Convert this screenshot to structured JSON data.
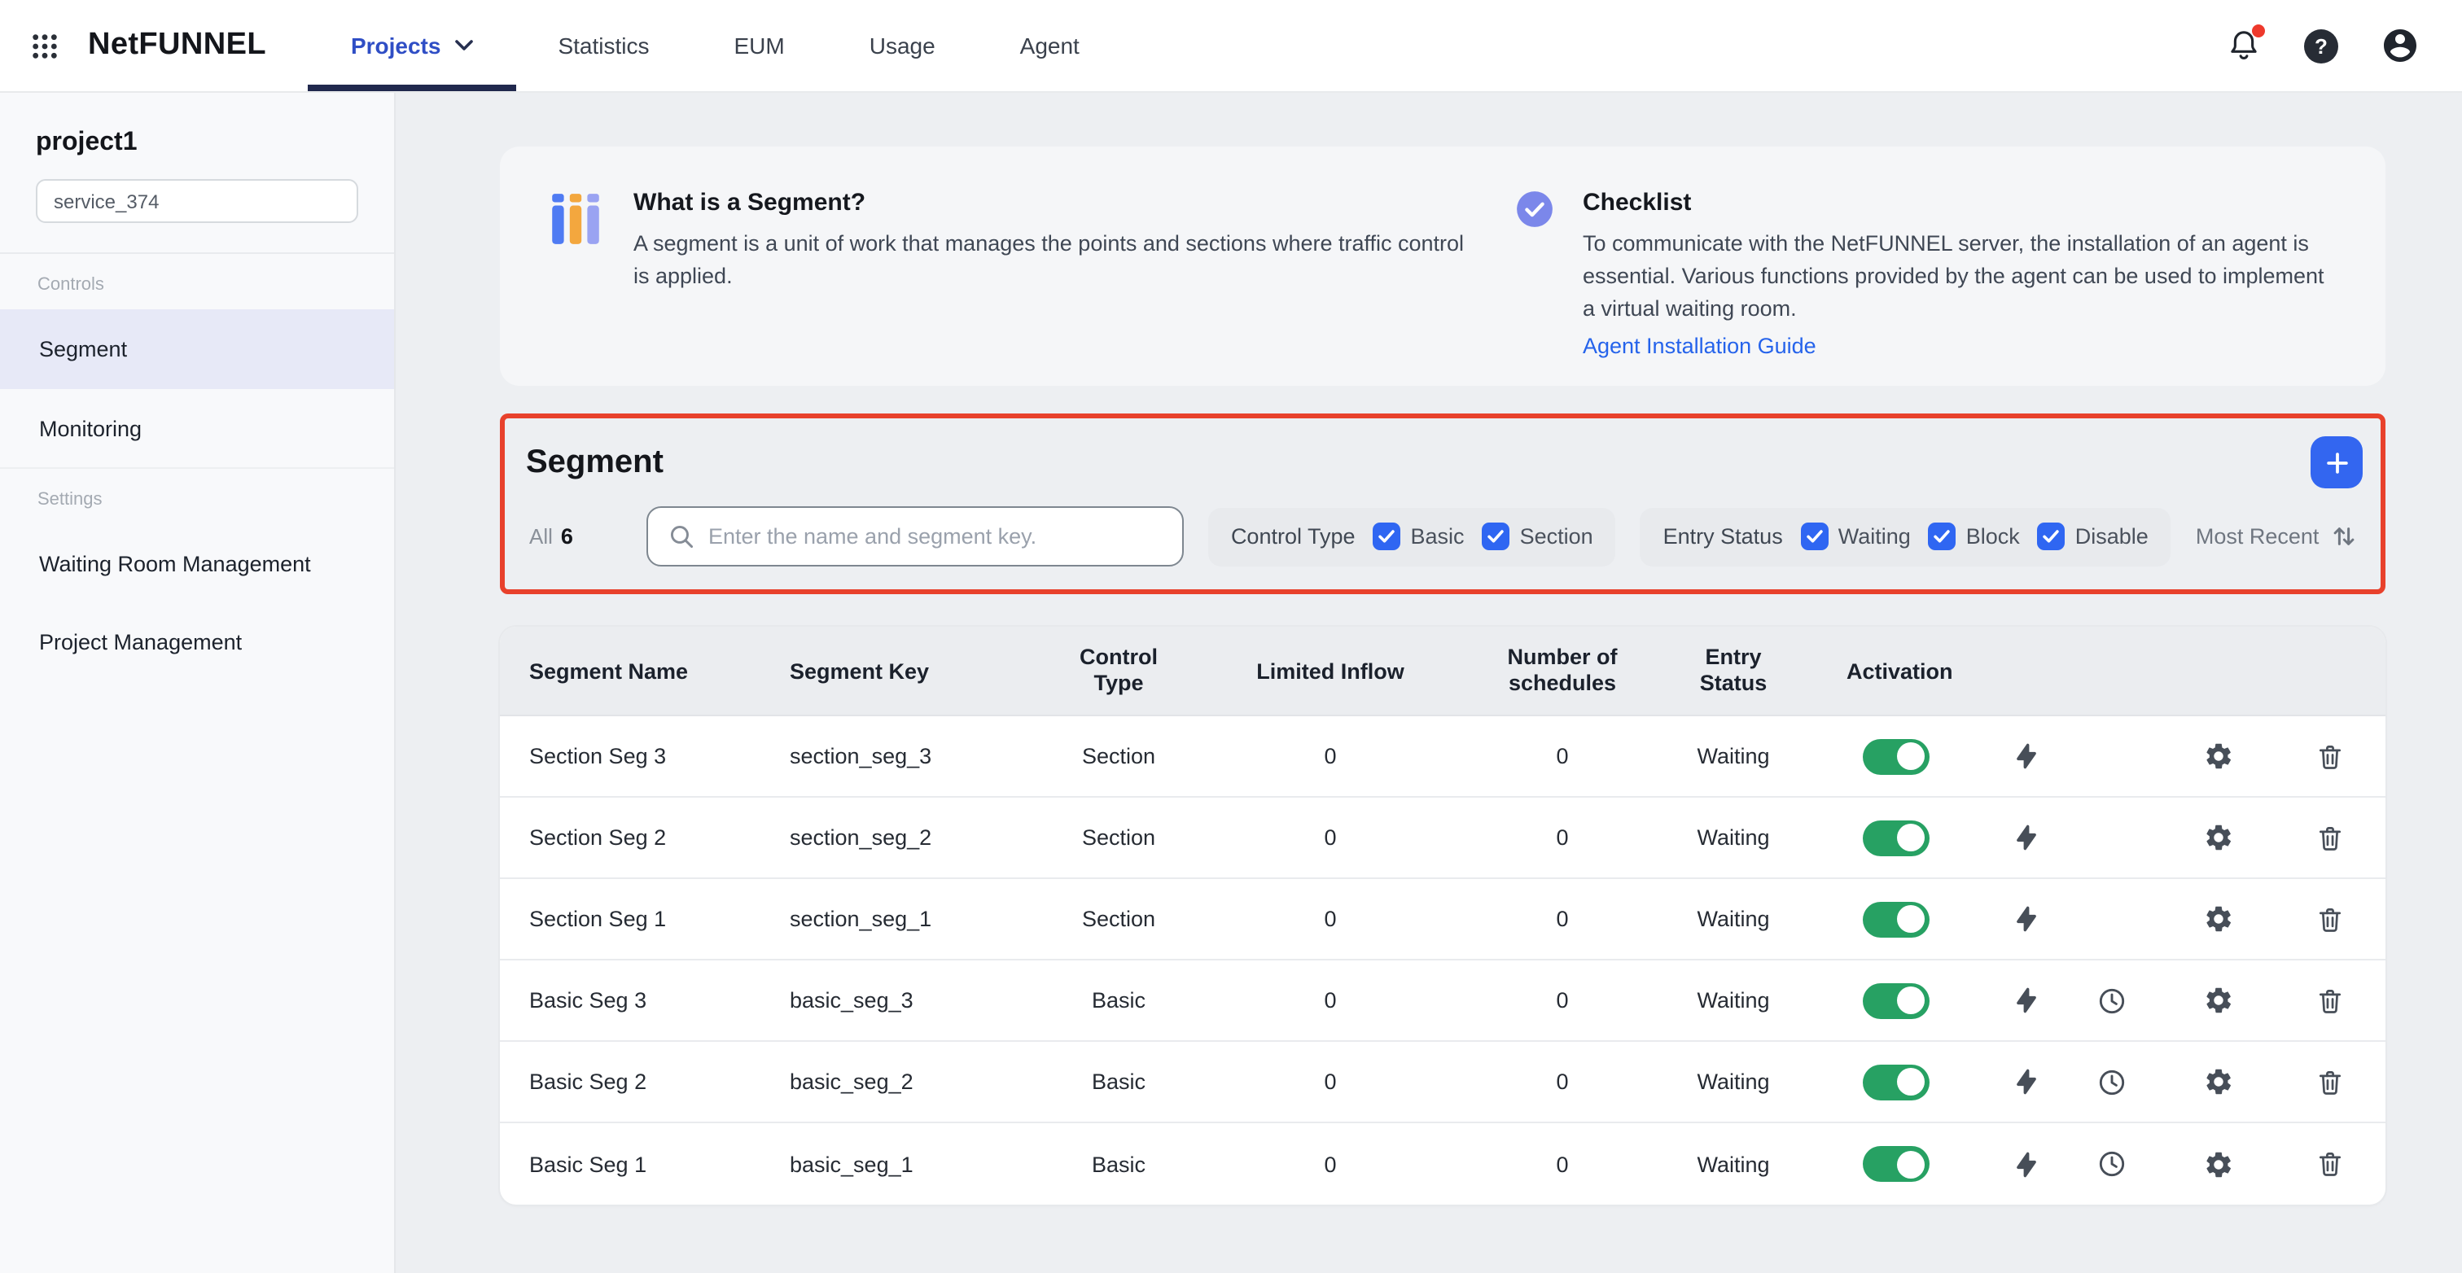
{
  "topbar": {
    "brand": "NetFUNNEL",
    "nav": {
      "projects": "Projects",
      "statistics": "Statistics",
      "eum": "EUM",
      "usage": "Usage",
      "agent": "Agent"
    }
  },
  "sidebar": {
    "project_name": "project1",
    "service_selected": "service_374",
    "controls_label": "Controls",
    "controls_items": {
      "segment": "Segment",
      "monitoring": "Monitoring"
    },
    "settings_label": "Settings",
    "settings_items": {
      "waiting_room": "Waiting Room Management",
      "project_mgmt": "Project Management"
    }
  },
  "cards": {
    "segment_info": {
      "title": "What is a Segment?",
      "body": "A segment is a unit of work that manages the points and sections where traffic control is applied."
    },
    "checklist": {
      "title": "Checklist",
      "body": "To communicate with the NetFUNNEL server, the installation of an agent is essential. Various functions provided by the agent can be used to implement a virtual waiting room.",
      "link": "Agent Installation Guide"
    }
  },
  "segment_panel": {
    "title": "Segment",
    "all_label": "All",
    "all_count": "6",
    "search_placeholder": "Enter the name and segment key.",
    "control_type_label": "Control Type",
    "control_type_options": {
      "basic": "Basic",
      "section": "Section"
    },
    "entry_status_label": "Entry Status",
    "entry_status_options": {
      "waiting": "Waiting",
      "block": "Block",
      "disable": "Disable"
    },
    "sort_label": "Most Recent"
  },
  "table": {
    "headers": {
      "name": "Segment Name",
      "key": "Segment Key",
      "control_type": "Control Type",
      "limited_inflow": "Limited Inflow",
      "schedules": "Number of schedules",
      "entry_status": "Entry Status",
      "activation": "Activation"
    },
    "rows": [
      {
        "name": "Section Seg 3",
        "key": "section_seg_3",
        "control_type": "Section",
        "limited_inflow": "0",
        "schedules": "0",
        "entry_status": "Waiting"
      },
      {
        "name": "Section Seg 2",
        "key": "section_seg_2",
        "control_type": "Section",
        "limited_inflow": "0",
        "schedules": "0",
        "entry_status": "Waiting"
      },
      {
        "name": "Section Seg 1",
        "key": "section_seg_1",
        "control_type": "Section",
        "limited_inflow": "0",
        "schedules": "0",
        "entry_status": "Waiting"
      },
      {
        "name": "Basic Seg 3",
        "key": "basic_seg_3",
        "control_type": "Basic",
        "limited_inflow": "0",
        "schedules": "0",
        "entry_status": "Waiting"
      },
      {
        "name": "Basic Seg 2",
        "key": "basic_seg_2",
        "control_type": "Basic",
        "limited_inflow": "0",
        "schedules": "0",
        "entry_status": "Waiting"
      },
      {
        "name": "Basic Seg 1",
        "key": "basic_seg_1",
        "control_type": "Basic",
        "limited_inflow": "0",
        "schedules": "0",
        "entry_status": "Waiting"
      }
    ]
  },
  "colors": {
    "accent_blue": "#3366f0",
    "checkbox_blue": "#2f66f2",
    "toggle_green": "#27a163",
    "highlight_red": "#e8412c",
    "nav_underline": "#20284d",
    "link_blue": "#2563eb"
  }
}
